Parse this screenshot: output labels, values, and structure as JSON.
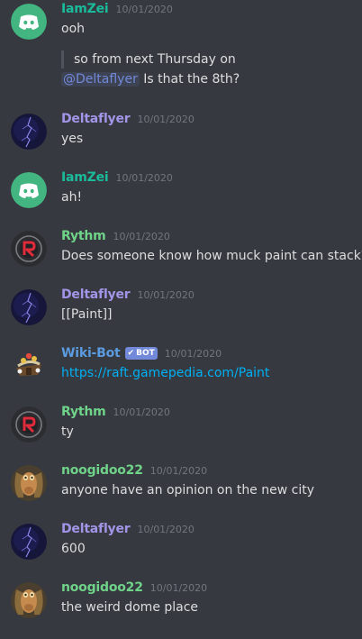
{
  "colors": {
    "background": "#36393f",
    "iamzei": "#1abc9c",
    "deltaflyer": "#a295e8",
    "green_user": "#6fd389",
    "wikibot": "#5b9bdf",
    "link": "#00b0f4",
    "mention": "#7289da"
  },
  "messages": [
    {
      "author": "IamZei",
      "timestamp": "10/01/2020",
      "avatar_icon": "discord-logo-icon",
      "text": "ooh",
      "quote": "so from next Thursday on",
      "mention": "@Deltaflyer",
      "reply": " Is that the 8th?"
    },
    {
      "author": "Deltaflyer",
      "timestamp": "10/01/2020",
      "avatar_icon": "lightning-icon",
      "text": "yes"
    },
    {
      "author": "IamZei",
      "timestamp": "10/01/2020",
      "avatar_icon": "discord-logo-icon",
      "text": "ah!"
    },
    {
      "author": "Rythm",
      "timestamp": "10/01/2020",
      "avatar_icon": "rythm-logo-icon",
      "text": "Does someone know how muck paint can stack?"
    },
    {
      "author": "Deltaflyer",
      "timestamp": "10/01/2020",
      "avatar_icon": "lightning-icon",
      "text": "[[Paint]]"
    },
    {
      "author": "Wiki-Bot",
      "bot_tag": "BOT",
      "timestamp": "10/01/2020",
      "avatar_icon": "wiki-bot-icon",
      "text": "https://raft.gamepedia.com/Paint"
    },
    {
      "author": "Rythm",
      "timestamp": "10/01/2020",
      "avatar_icon": "rythm-logo-icon",
      "text": "ty"
    },
    {
      "author": "noogidoo22",
      "timestamp": "10/01/2020",
      "avatar_icon": "jarjar-avatar-icon",
      "text": "anyone have an opinion on the new city"
    },
    {
      "author": "Deltaflyer",
      "timestamp": "10/01/2020",
      "avatar_icon": "lightning-icon",
      "text": "600"
    },
    {
      "author": "noogidoo22",
      "timestamp": "10/01/2020",
      "avatar_icon": "jarjar-avatar-icon",
      "text": "the weird dome place"
    }
  ]
}
